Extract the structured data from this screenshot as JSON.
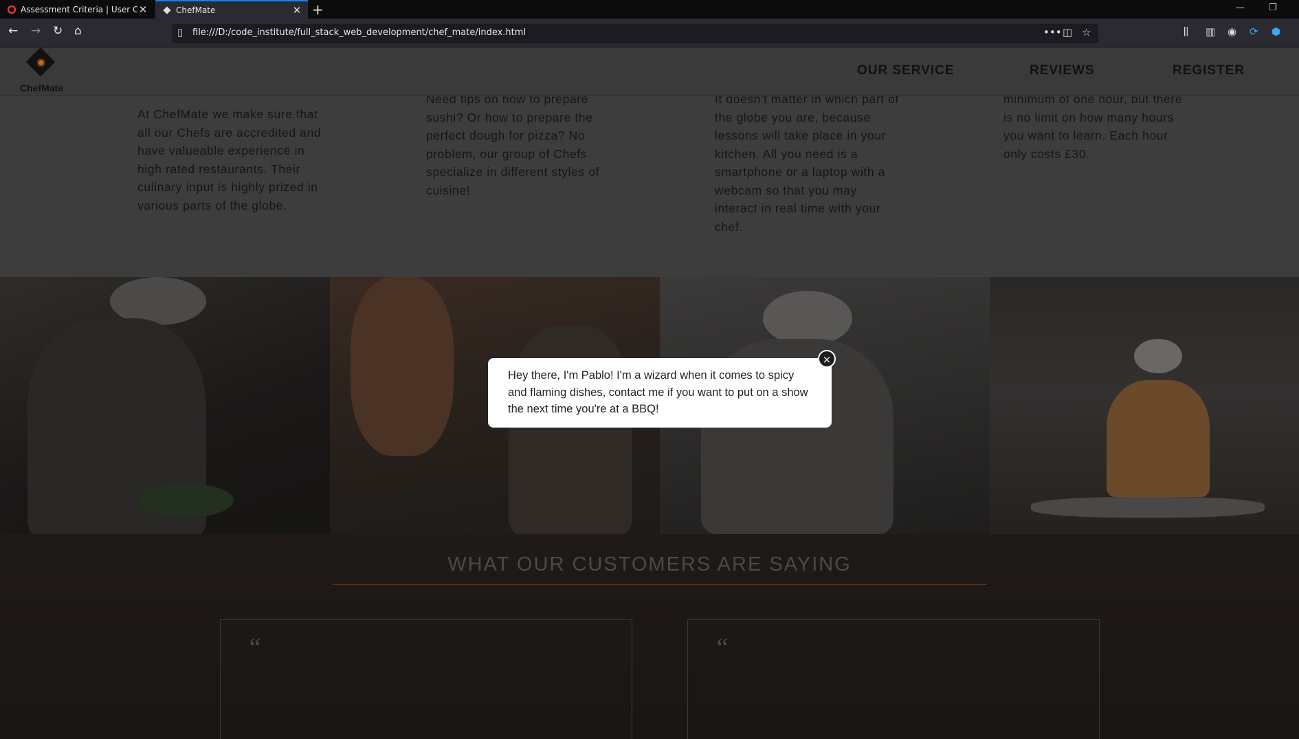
{
  "browser": {
    "tabs": [
      {
        "title": "Assessment Criteria | User Cent",
        "active": false
      },
      {
        "title": "ChefMate",
        "active": true
      }
    ],
    "url": "file:///D:/code_institute/full_stack_web_development/chef_mate/index.html"
  },
  "site": {
    "logo_text": "ChefMate",
    "nav": [
      "OUR SERVICE",
      "REVIEWS",
      "REGISTER"
    ]
  },
  "features": [
    "At ChefMate we make sure that all our Chefs are accredited and have valueable experience in high rated restaurants. Their culinary input is highly prized in various parts of the globe.",
    "Need tips on how to prepare sushi? Or how to prepare the perfect dough for pizza? No problem, our group of Chefs specialize in different styles of cuisine!",
    "It doesn't matter in which part of the globe you are, because lessons will take place in your kitchen. All you need is a smartphone or a laptop with a webcam so that you may interact in real time with your chef.",
    "minimum of one hour, but there is no limit on how many hours you want to learn. Each hour only costs £30."
  ],
  "reviews": {
    "title": "WHAT OUR CUSTOMERS ARE SAYING",
    "quote_mark": "“"
  },
  "popup": {
    "text": "Hey there, I'm Pablo! I'm a wizard when it comes to spicy and flaming dishes, contact me if you want to put on a show the next time you're at a BBQ!",
    "close": "×"
  },
  "colors": {
    "accent": "#6a3414",
    "overlay": "#000000"
  }
}
